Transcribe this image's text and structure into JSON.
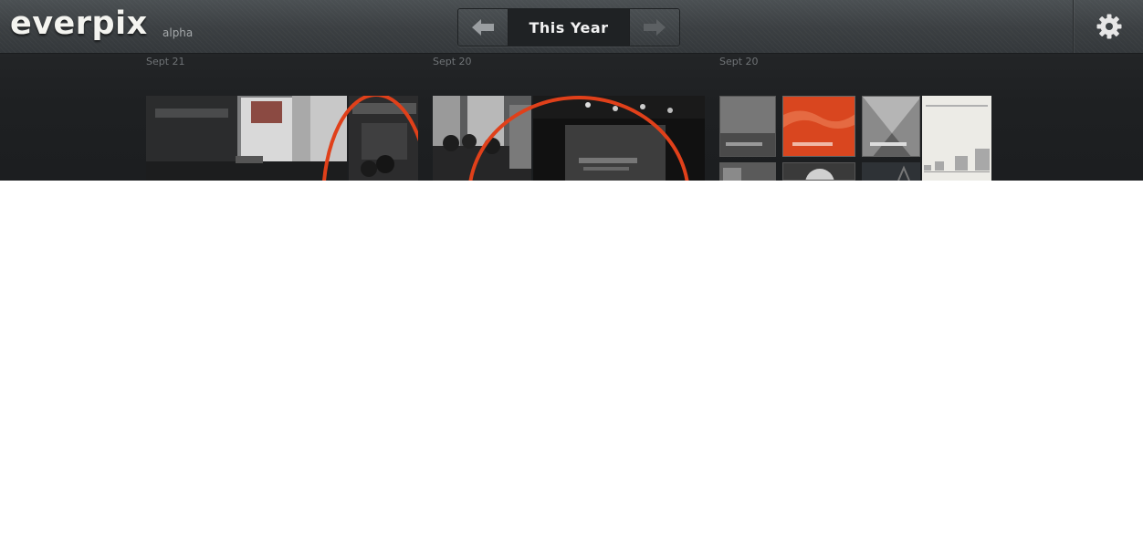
{
  "app": {
    "logo": "everpix",
    "logo_sub": "alpha"
  },
  "nav": {
    "title": "This Year",
    "prev_icon": "arrow-left-icon",
    "next_icon": "arrow-right-icon"
  },
  "settings": {
    "icon": "gear-icon"
  },
  "groups": [
    {
      "date": "Sept 21"
    },
    {
      "date": "Sept 20"
    },
    {
      "date": "Sept 20"
    }
  ],
  "colors": {
    "topbar": "#3f4447",
    "strip": "#1f2123",
    "accent_circle": "#e0401a",
    "logo_text": "#f4f4f0"
  }
}
